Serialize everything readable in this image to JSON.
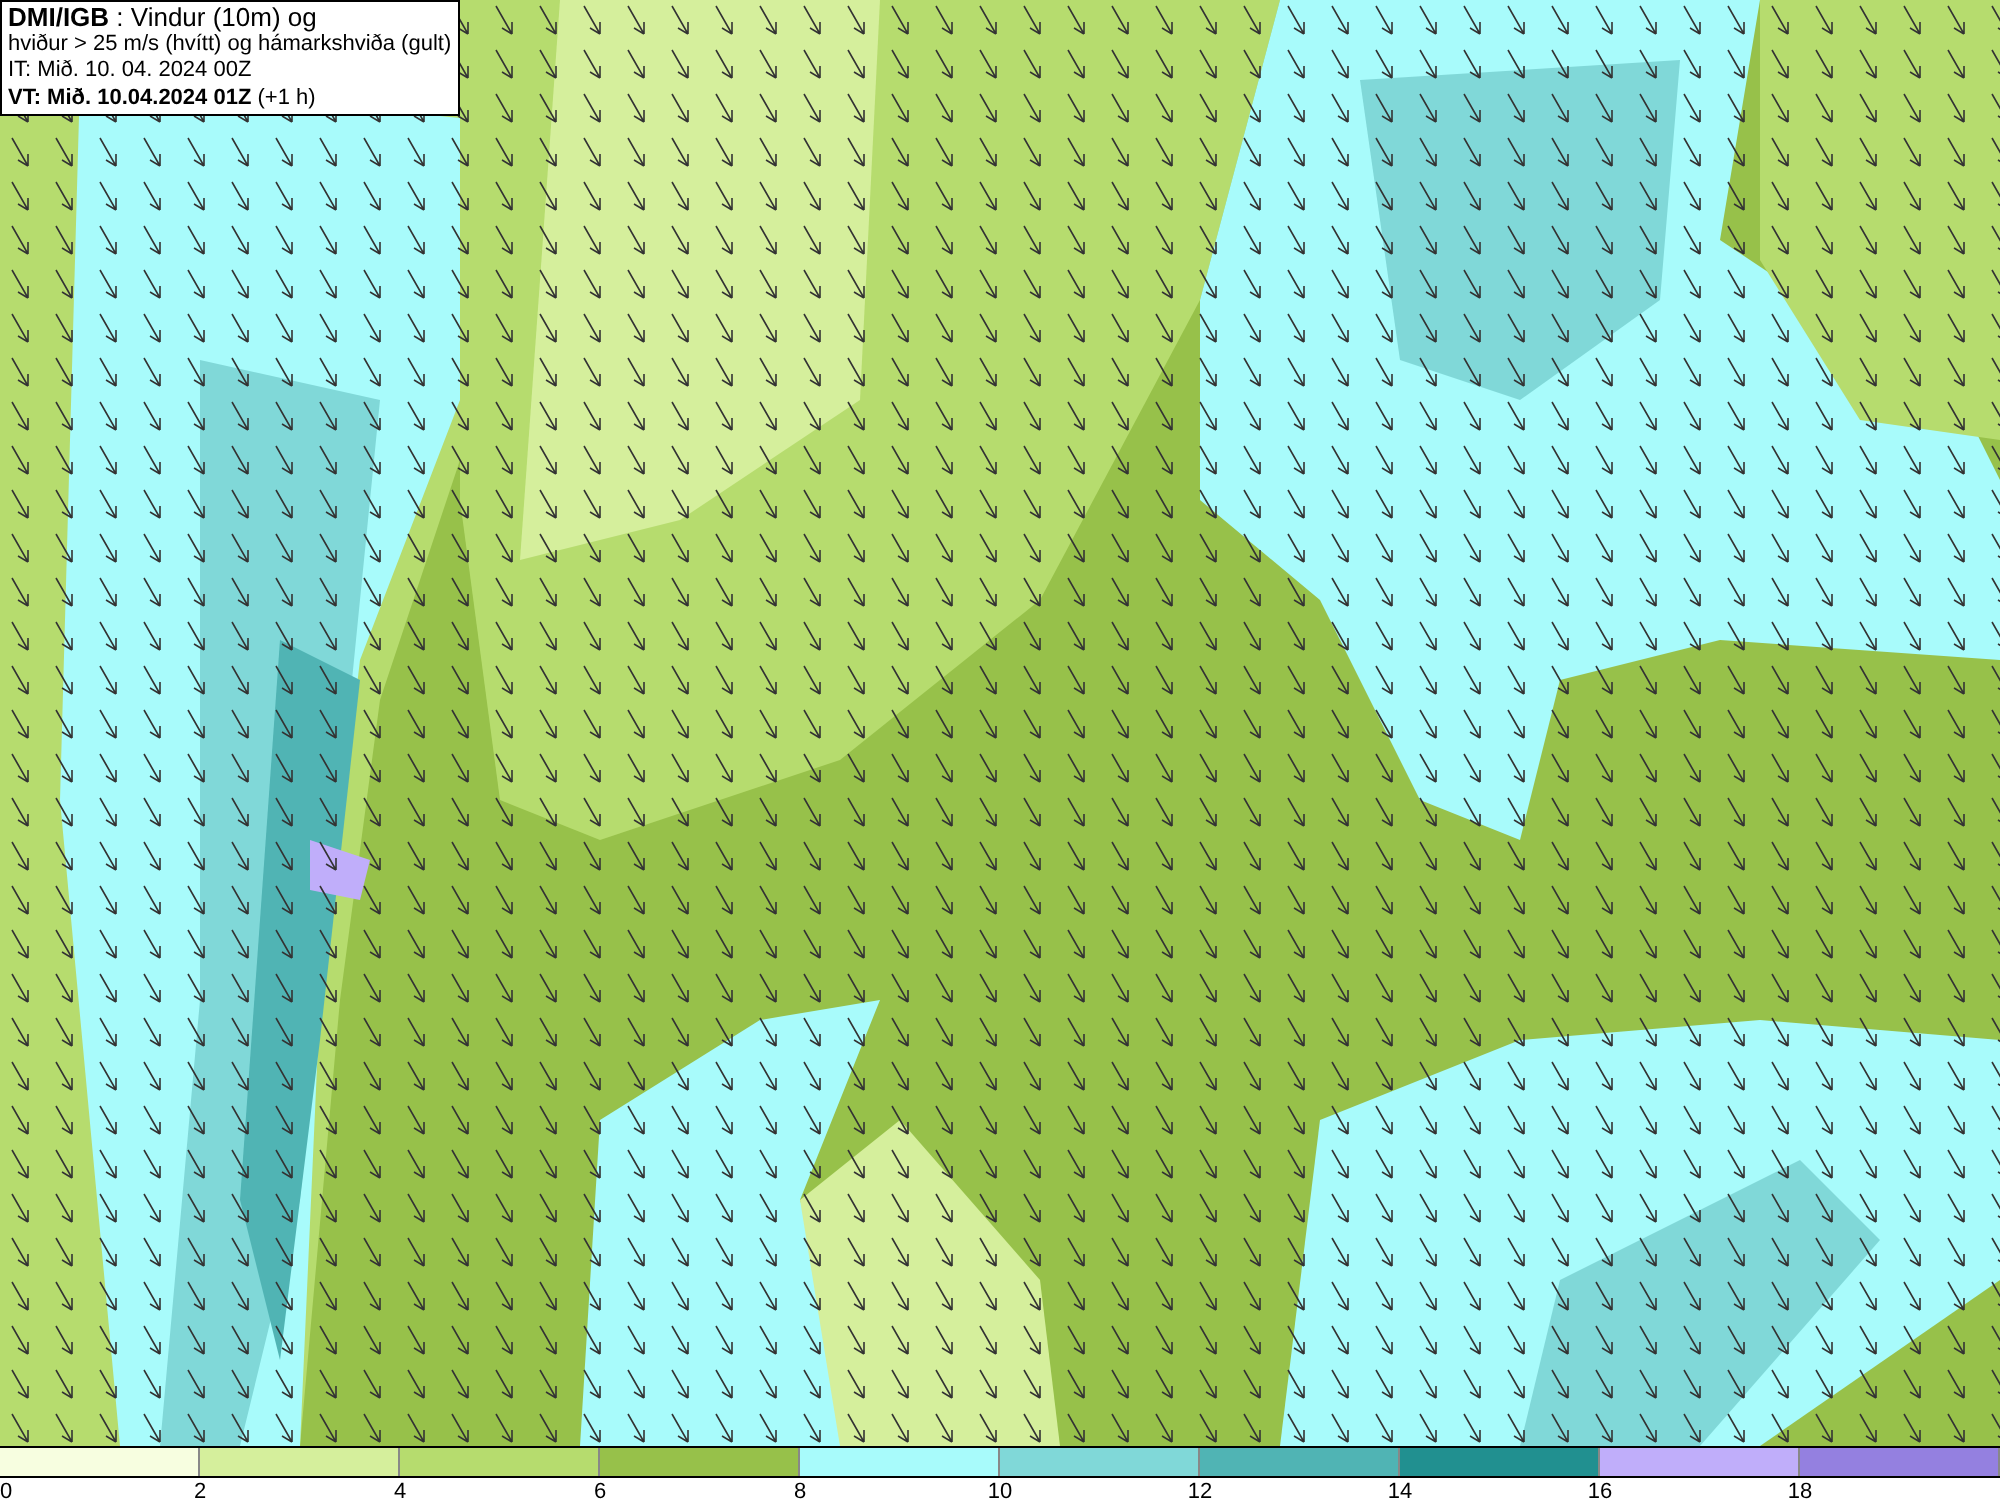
{
  "header": {
    "lines": [
      "**DMI/IGB** : Vindur (10m) og",
      "hviður > 25 m/s (hvítt) og hámarkshviða (gult)",
      "IT: Mið. 10. 04. 2024 00Z",
      "**VT: Mið. 10.04.2024 01Z** (+1 h)"
    ]
  },
  "legend": {
    "bins": [
      {
        "color": "#f7fee0",
        "label": "0"
      },
      {
        "color": "#d5ef9c",
        "label": "2"
      },
      {
        "color": "#b6dc6e",
        "label": "4"
      },
      {
        "color": "#97c14a",
        "label": "6"
      },
      {
        "color": "#a8fbfb",
        "label": "8"
      },
      {
        "color": "#80d8d8",
        "label": "10"
      },
      {
        "color": "#50b4b4",
        "label": "12"
      },
      {
        "color": "#219090",
        "label": "14"
      },
      {
        "color": "#c0aefa",
        "label": "16"
      },
      {
        "color": "#9480e0",
        "label": "18"
      }
    ]
  }
}
